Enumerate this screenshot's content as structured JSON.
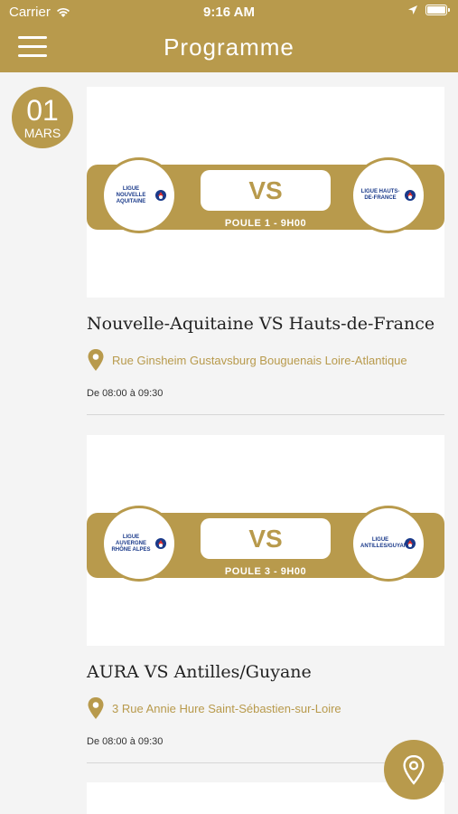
{
  "status_bar": {
    "carrier": "Carrier",
    "time": "9:16 AM"
  },
  "navbar": {
    "title": "Programme",
    "menu_icon": "hamburger-menu-icon"
  },
  "date": {
    "day": "01",
    "month": "MARS"
  },
  "matches": [
    {
      "team_left_logo": "LIGUE NOUVELLE AQUITAINE",
      "team_right_logo": "LIGUE HAUTS-DE-FRANCE",
      "vs_label": "VS",
      "poule": "POULE 1 - 9H00",
      "title": "Nouvelle-Aquitaine VS Hauts-de-France",
      "address": "Rue Ginsheim Gustavsburg Bouguenais Loire-Atlantique",
      "hours": "De 08:00 à 09:30"
    },
    {
      "team_left_logo": "LIGUE AUVERGNE RHÔNE ALPES",
      "team_right_logo": "LIGUE ANTILLES/GUYANE",
      "vs_label": "VS",
      "poule": "POULE 3 - 9H00",
      "title": "AURA VS Antilles/Guyane",
      "address": "3 Rue Annie Hure Saint-Sébastien-sur-Loire",
      "hours": "De 08:00 à 09:30"
    }
  ],
  "colors": {
    "accent": "#b89a4c",
    "background": "#f4f4f4"
  },
  "fab_icon": "location-pin-icon"
}
